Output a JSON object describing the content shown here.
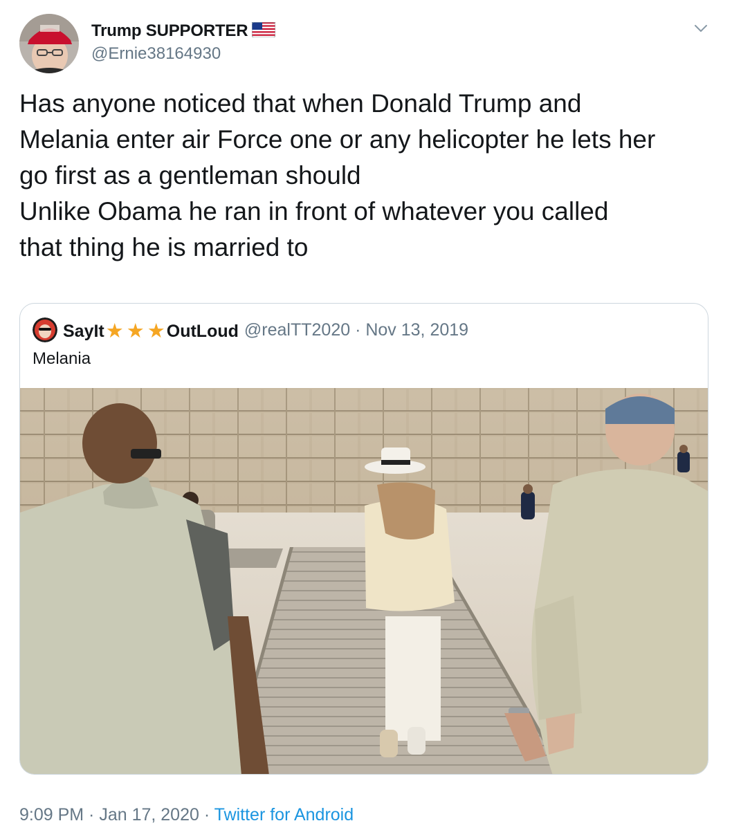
{
  "tweet": {
    "author": {
      "display_name": "Trump SUPPORTER",
      "handle": "@Ernie38164930",
      "avatar_icon": "user-avatar-red-cap",
      "flag_icon": "us-flag-emoji"
    },
    "text_lines": [
      "Has anyone noticed that when Donald Trump and",
      "Melania enter air Force one or any helicopter he lets her",
      "go first as a gentleman should",
      "Unlike Obama he ran in front of whatever you called",
      "that thing he is married to"
    ],
    "menu_icon": "chevron-down-icon",
    "timestamp": "9:09 PM · Jan 17, 2020 · ",
    "source": "Twitter for Android"
  },
  "quoted": {
    "name_part1": "SayIt",
    "stars": [
      "★",
      "★",
      "★"
    ],
    "name_part2": "OutLoud",
    "handle_date": "@realTT2020 · Nov 13, 2019",
    "text": "Melania",
    "media_icon": "video-thumbnail-pyramids",
    "colors": {
      "star": "#f5a623",
      "link": "#1b95e0",
      "secondary": "#657786",
      "border": "#ccd6dd"
    }
  }
}
